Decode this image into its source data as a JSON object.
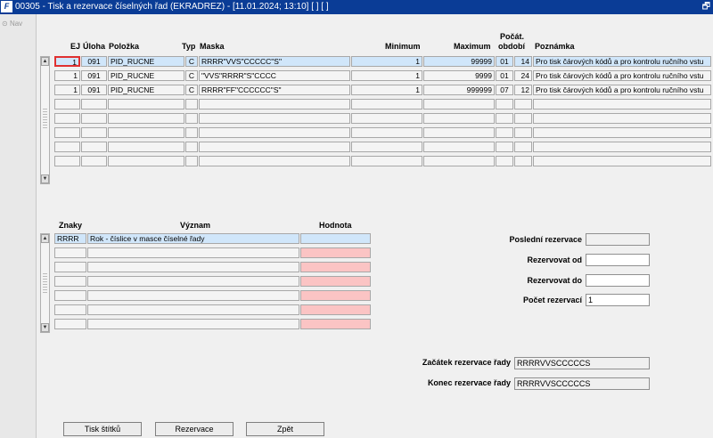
{
  "window": {
    "title": "00305 - Tisk a rezervace číselných řad (EKRADREZ) - [11.01.2024; 13:10] [ ] [ ]",
    "app_icon": "oracle-forms-icon",
    "restore_glyph": "🗗"
  },
  "nav": {
    "label": "Nav"
  },
  "grid1": {
    "headers": {
      "ej": "EJ",
      "uloha": "Úloha",
      "polozka": "Položka",
      "typ": "Typ",
      "maska": "Maska",
      "minimum": "Minimum",
      "maximum": "Maximum",
      "pocat": "Počát.",
      "obdobi": "období",
      "poznamka": "Poznámka"
    },
    "rows": [
      [
        "1",
        "091",
        "PID_RUCNE",
        "C",
        "RRRR\"VVS\"CCCCC\"S\"",
        "1",
        "99999",
        "01",
        "14",
        "Pro tisk čárových kódů a pro kontrolu ručního vstu"
      ],
      [
        "1",
        "091",
        "PID_RUCNE",
        "C",
        "\"VVS\"RRRR\"S\"CCCC",
        "1",
        "9999",
        "01",
        "24",
        "Pro tisk čárových kódů a pro kontrolu ručního vstu"
      ],
      [
        "1",
        "091",
        "PID_RUCNE",
        "C",
        "RRRR\"FF\"CCCCCC\"S\"",
        "1",
        "999999",
        "07",
        "12",
        "Pro tisk čárových kódů a pro kontrolu ručního vstu"
      ]
    ]
  },
  "grid2": {
    "headers": {
      "znaky": "Znaky",
      "vyznam": "Význam",
      "hodnota": "Hodnota"
    },
    "rows": [
      [
        "RRRR",
        "Rok - číslice v masce číselné řady",
        ""
      ]
    ]
  },
  "form": {
    "posledni_label": "Poslední rezervace",
    "posledni_value": "",
    "od_label": "Rezervovat od",
    "od_value": "",
    "do_label": "Rezervovat do",
    "do_value": "",
    "pocet_label": "Počet rezervací",
    "pocet_value": "1",
    "zacatek_label": "Začátek rezervace řady",
    "zacatek_value": "RRRRVVSCCCCCS",
    "konec_label": "Konec rezervace řady",
    "konec_value": "RRRRVVSCCCCCS"
  },
  "buttons": {
    "tisk": "Tisk štítků",
    "rezervace": "Rezervace",
    "zpet": "Zpět"
  }
}
